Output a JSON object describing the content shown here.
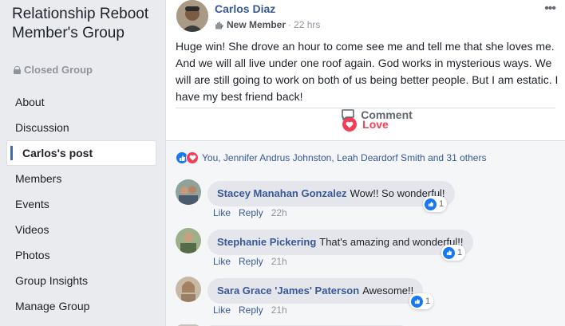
{
  "group": {
    "title": "Relationship Reboot Member's Group",
    "privacy": "Closed Group"
  },
  "nav": [
    {
      "label": "About"
    },
    {
      "label": "Discussion"
    },
    {
      "label": "Carlos's post"
    },
    {
      "label": "Members"
    },
    {
      "label": "Events"
    },
    {
      "label": "Videos"
    },
    {
      "label": "Photos"
    },
    {
      "label": "Group Insights"
    },
    {
      "label": "Manage Group"
    }
  ],
  "post": {
    "author": "Carlos Diaz",
    "badge": "New Member",
    "separator": "·",
    "time": "22 hrs",
    "more_icon": "more-options-icon",
    "text": "Huge win! She drove an hour to come see me and tell me that she loves me. And we will all live under one roof again. God works in mysterious ways. We will are still going to work on both of us being better people. But I am estatic. I have my best friend back!",
    "love_label": "Love",
    "comment_label": "Comment",
    "reactions_text": "You, Jennifer Andrus Johnston, Leah Deardorf Smith and 31 others"
  },
  "comments": [
    {
      "name": "Stacey Manahan Gonzalez",
      "text": "Wow!! So wonderful!",
      "like": "Like",
      "reply": "Reply",
      "time": "22h",
      "reactions": "1"
    },
    {
      "name": "Stephanie Pickering",
      "text": "That's amazing and wonderful!!",
      "like": "Like",
      "reply": "Reply",
      "time": "21h",
      "reactions": "1"
    },
    {
      "name": "Sara Grace 'James' Paterson",
      "text": "Awesome!!",
      "like": "Like",
      "reply": "Reply",
      "time": "21h",
      "reactions": "1"
    }
  ],
  "colors": {
    "link": "#365899",
    "love": "#f33e58",
    "like": "#1877f2",
    "page_bg": "#e9ebee"
  }
}
